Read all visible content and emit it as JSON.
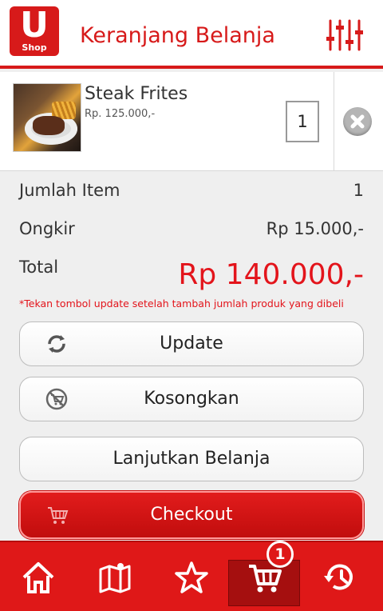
{
  "header": {
    "logo_letter": "U",
    "logo_sub": "Shop",
    "title": "Keranjang Belanja",
    "filter_icon": "sliders-icon"
  },
  "cart": {
    "items": [
      {
        "name": "Steak Frites",
        "price": "Rp. 125.000,-",
        "quantity": "1"
      }
    ]
  },
  "summary": {
    "jumlah_label": "Jumlah Item",
    "jumlah_value": "1",
    "ongkir_label": "Ongkir",
    "ongkir_value": "Rp 15.000,-",
    "total_label": "Total",
    "total_value": "Rp 140.000,-",
    "note": "*Tekan tombol update setelah tambah jumlah produk yang dibeli"
  },
  "actions": {
    "update": "Update",
    "kosongkan": "Kosongkan",
    "lanjutkan": "Lanjutkan Belanja",
    "checkout": "Checkout"
  },
  "nav": {
    "items": [
      "home-icon",
      "map-icon",
      "star-icon",
      "cart-icon",
      "history-icon"
    ],
    "active": "cart-icon",
    "cart_badge": "1"
  },
  "colors": {
    "brand_red": "#d71a1a",
    "price_red": "#e3141b",
    "nav_bg": "#df1818"
  }
}
